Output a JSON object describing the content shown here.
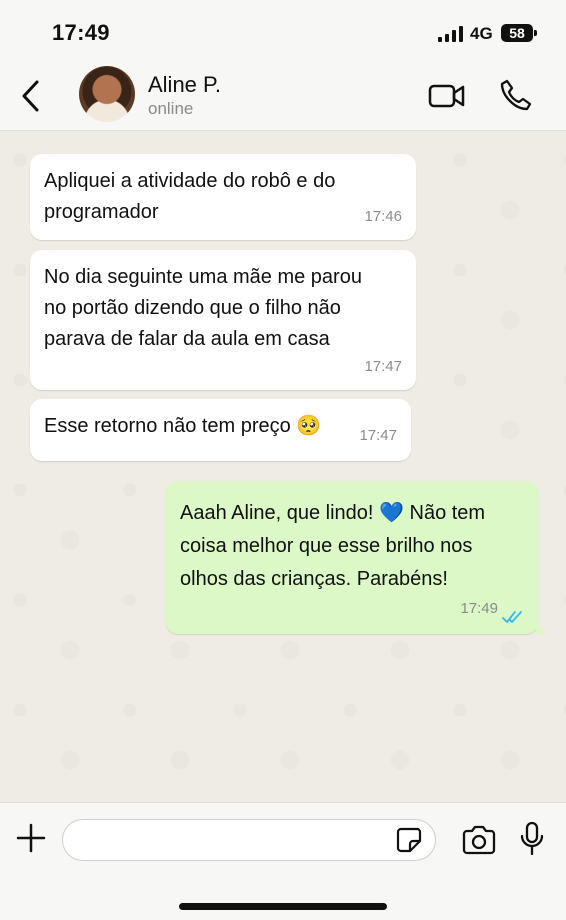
{
  "status_bar": {
    "time": "17:49",
    "network": "4G",
    "battery": "58"
  },
  "header": {
    "contact_name": "Aline P.",
    "contact_status": "online"
  },
  "messages": [
    {
      "direction": "incoming",
      "text": "Apliquei a atividade do robô e do programador",
      "time": "17:46"
    },
    {
      "direction": "incoming",
      "text": "No dia seguinte uma mãe me parou no portão dizendo que o filho não parava de falar da aula em casa",
      "time": "17:47"
    },
    {
      "direction": "incoming",
      "text": "Esse retorno não tem preço 🥺",
      "time": "17:47"
    },
    {
      "direction": "outgoing",
      "text": "Aaah Aline, que lindo! 💙 Não tem coisa melhor que esse brilho nos olhos das crianças. Parabéns!",
      "time": "17:49",
      "read": true
    }
  ],
  "input": {
    "value": "",
    "placeholder": ""
  },
  "icons": {
    "back": "chevron-left-icon",
    "video": "video-camera-icon",
    "call": "phone-icon",
    "plus": "plus-icon",
    "sticker": "sticker-icon",
    "camera": "camera-icon",
    "mic": "microphone-icon",
    "read_receipt": "double-check-icon"
  },
  "colors": {
    "outgoing_bubble": "#dcf8c6",
    "incoming_bubble": "#ffffff",
    "read_ticks": "#34b7f1",
    "wallpaper": "#efece5"
  }
}
